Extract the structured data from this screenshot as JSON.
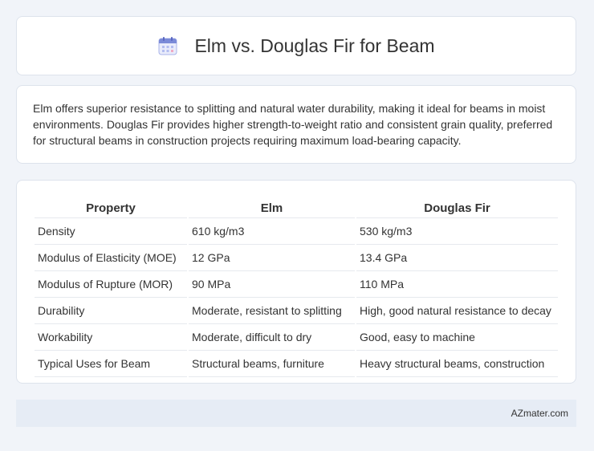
{
  "header": {
    "title": "Elm vs. Douglas Fir for Beam",
    "icon": "calendar-icon"
  },
  "description": "Elm offers superior resistance to splitting and natural water durability, making it ideal for beams in moist environments. Douglas Fir provides higher strength-to-weight ratio and consistent grain quality, preferred for structural beams in construction projects requiring maximum load-bearing capacity.",
  "table": {
    "headers": [
      "Property",
      "Elm",
      "Douglas Fir"
    ],
    "rows": [
      [
        "Density",
        "610 kg/m3",
        "530 kg/m3"
      ],
      [
        "Modulus of Elasticity (MOE)",
        "12 GPa",
        "13.4 GPa"
      ],
      [
        "Modulus of Rupture (MOR)",
        "90 MPa",
        "110 MPa"
      ],
      [
        "Durability",
        "Moderate, resistant to splitting",
        "High, good natural resistance to decay"
      ],
      [
        "Workability",
        "Moderate, difficult to dry",
        "Good, easy to machine"
      ],
      [
        "Typical Uses for Beam",
        "Structural beams, furniture",
        "Heavy structural beams, construction"
      ]
    ]
  },
  "footer": {
    "brand": "AZmater.com"
  },
  "colors": {
    "background": "#f1f4f9",
    "card": "#ffffff",
    "footer": "#e6ecf5",
    "icon_accent": "#7b8bd8"
  }
}
